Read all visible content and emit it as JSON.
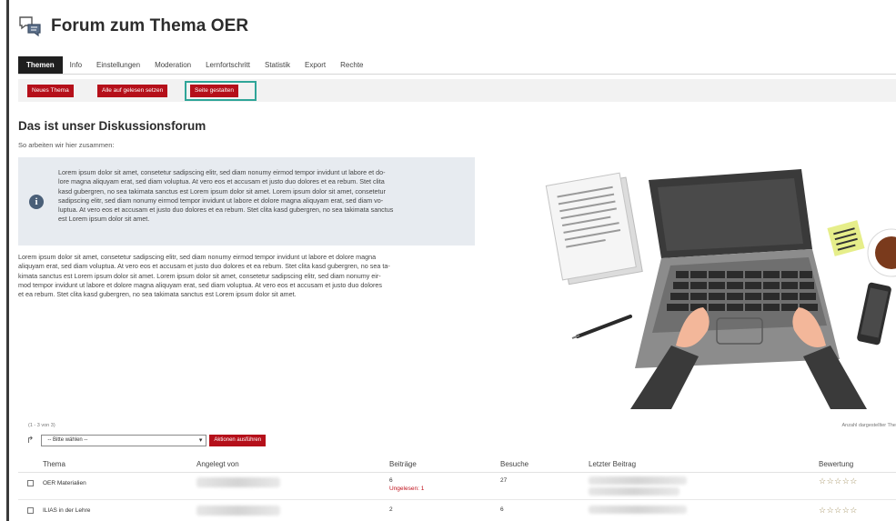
{
  "header": {
    "title": "Forum zum Thema OER",
    "icon": "forum-icon"
  },
  "tabs": [
    "Themen",
    "Info",
    "Einstellungen",
    "Moderation",
    "Lernfortschritt",
    "Statistik",
    "Export",
    "Rechte"
  ],
  "toolbar": {
    "new_topic": "Neues Thema",
    "mark_all_read": "Alle auf gelesen setzen",
    "design_page": "Seite gestalten",
    "highlight_color": "#2fa598",
    "button_color": "#b5101a"
  },
  "content": {
    "title": "Das ist unser Diskussionsforum",
    "subtitle": "So arbeiten wir hier zusammen:",
    "info_lines": [
      "Lorem ipsum dolor sit amet, consetetur sadipscing elitr, sed diam nonumy eirmod tempor invidunt ut labore et do-",
      "lore magna aliquyam erat, sed diam voluptua. At vero eos et accusam et justo duo dolores et ea rebum. Stet clita",
      "kasd gubergren, no sea takimata sanctus est Lorem ipsum dolor sit amet. Lorem ipsum dolor sit amet, consetetur",
      "sadipscing elitr, sed diam nonumy eirmod tempor invidunt ut labore et dolore magna aliquyam erat, sed diam vo-",
      "luptua. At vero eos et accusam et justo duo dolores et ea rebum. Stet clita kasd gubergren, no sea takimata sanctus",
      "est Lorem ipsum dolor sit amet."
    ],
    "body_lines": [
      "Lorem ipsum dolor sit amet, consetetur sadipscing elitr, sed diam nonumy eirmod tempor invidunt ut labore et dolore magna",
      "aliquyam erat, sed diam voluptua. At vero eos et accusam et justo duo dolores et ea rebum. Stet clita kasd gubergren, no sea ta-",
      "kimata sanctus est Lorem ipsum dolor sit amet. Lorem ipsum dolor sit amet, consetetur sadipscing elitr, sed diam nonumy eir-",
      "mod tempor invidunt ut labore et dolore magna aliquyam erat, sed diam voluptua. At vero eos et accusam et justo duo dolores",
      "et ea rebum. Stet clita kasd gubergren, no sea takimata sanctus est Lorem ipsum dolor sit amet."
    ]
  },
  "table": {
    "count": "(1 - 3 von 3)",
    "count_right": "Anzahl dargestellter The",
    "select_value": "-- Bitte wählen --",
    "action_button": "Aktionen ausführen",
    "headers": {
      "topic": "Thema",
      "created_by": "Angelegt von",
      "posts": "Beiträge",
      "visits": "Besuche",
      "last_post": "Letzter Beitrag",
      "rating": "Bewertung"
    },
    "rows": [
      {
        "topic": "OER Materialien",
        "posts": "6",
        "unread": "Ungelesen: 1",
        "visits": "27",
        "rating": "☆☆☆☆☆"
      },
      {
        "topic": "ILIAS in der Lehre",
        "posts": "2",
        "unread": "",
        "visits": "6",
        "rating": "☆☆☆☆☆"
      }
    ]
  }
}
